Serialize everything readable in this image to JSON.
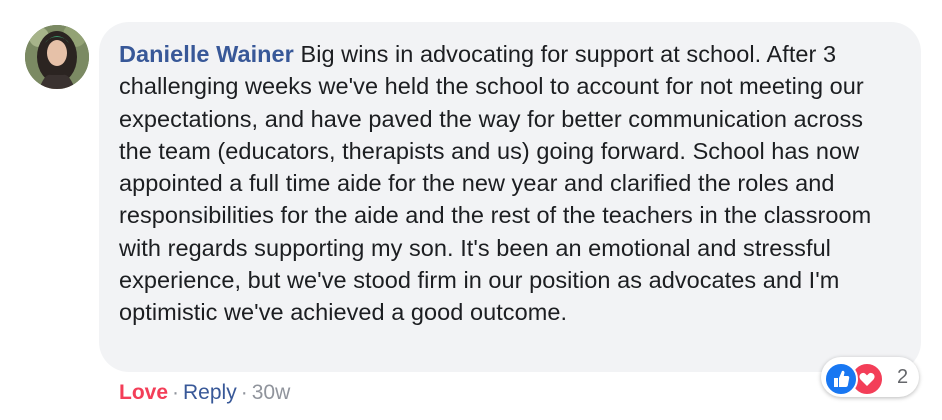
{
  "comment": {
    "author": "Danielle Wainer",
    "text": "Big wins in advocating for support at school. After 3 challenging weeks we've held the school to account for not meeting our expectations, and have paved the way for better communication across the team (educators, therapists and us) going forward. School has now appointed a full time aide for the new year and clarified the roles and responsibilities for the aide and the rest of the teachers in the classroom with regards supporting my son. It's been an emotional and stressful experience, but we've stood firm in our position as advocates and I'm optimistic we've achieved a good outcome."
  },
  "actions": {
    "love_label": "Love",
    "separator": "·",
    "reply_label": "Reply",
    "timestamp": "30w"
  },
  "reactions": {
    "icons": [
      "like-icon",
      "heart-icon"
    ],
    "count": "2"
  },
  "colors": {
    "author_link": "#385898",
    "love": "#f33e58",
    "bubble_background": "#f2f3f5",
    "muted_text": "#90949c",
    "like_blue": "#1877f2"
  }
}
